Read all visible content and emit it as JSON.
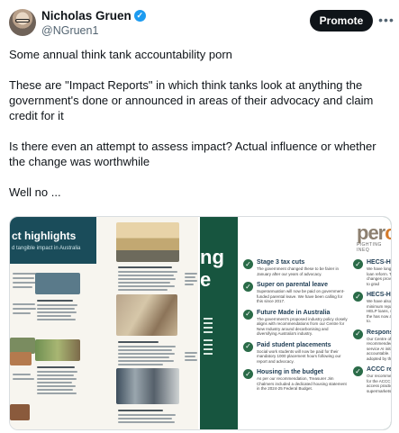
{
  "post": {
    "author_name": "Nicholas Gruen",
    "verified_icon": "verified-badge-icon",
    "handle": "@NGruen1",
    "promote_label": "Promote",
    "more_icon": "more-horizontal-icon",
    "paragraphs": [
      "Some annual think tank accountability porn",
      "These are \"Impact Reports\" in which think tanks look at anything the government's done or announced in areas of their advocacy and claim credit for it",
      "Is there even an attempt to assess impact? Actual influence or whether the change was worthwhile",
      "Well no ..."
    ]
  },
  "media": {
    "left_image": {
      "heading": "ct highlights",
      "subheading": "d tangible impact in Australia"
    },
    "right_image": {
      "side_title_line1": "ng",
      "side_title_line2": "e",
      "logo": "per",
      "logo_sub": "FIGHTING INEQ",
      "items": [
        {
          "title": "Stage 3 tax cuts",
          "body": "The government changed these to be fairer in January after our years of advocacy."
        },
        {
          "title": "Super on parental leave",
          "body": "Superannuation will now be paid on government-funded parental leave. We have been calling for this since 2017."
        },
        {
          "title": "Future Made in Australia",
          "body": "The government's proposed industry policy closely aligns with recommendations from our Centre for New Industry around decarbonising and diversifying Australia's industry."
        },
        {
          "title": "Paid student placements",
          "body": "Social work students will now be paid for their mandatory 1000 placement hours following our report and advocacy."
        },
        {
          "title": "Housing in the budget",
          "body": "As per our recommendation, Treasurer Jim Chalmers included a dedicated housing statement in the 2024-25 Federal Budget."
        }
      ],
      "items_right": [
        {
          "title": "HECS-HELP i",
          "body": "We have long argued loan reform. These changes provide relief to grad"
        },
        {
          "title": "HECS-HELP r",
          "body": "We have also argued minimum repayment HELP loans, which the has now agreed to."
        },
        {
          "title": "Responsible A",
          "body": "Our Centre of the recommended a new service AI initiatives accountable. This had adopted by the federal"
        },
        {
          "title": "ACCC resour",
          "body": "Our recommendation for the ACCC to access practices of supermarkets"
        }
      ]
    }
  }
}
